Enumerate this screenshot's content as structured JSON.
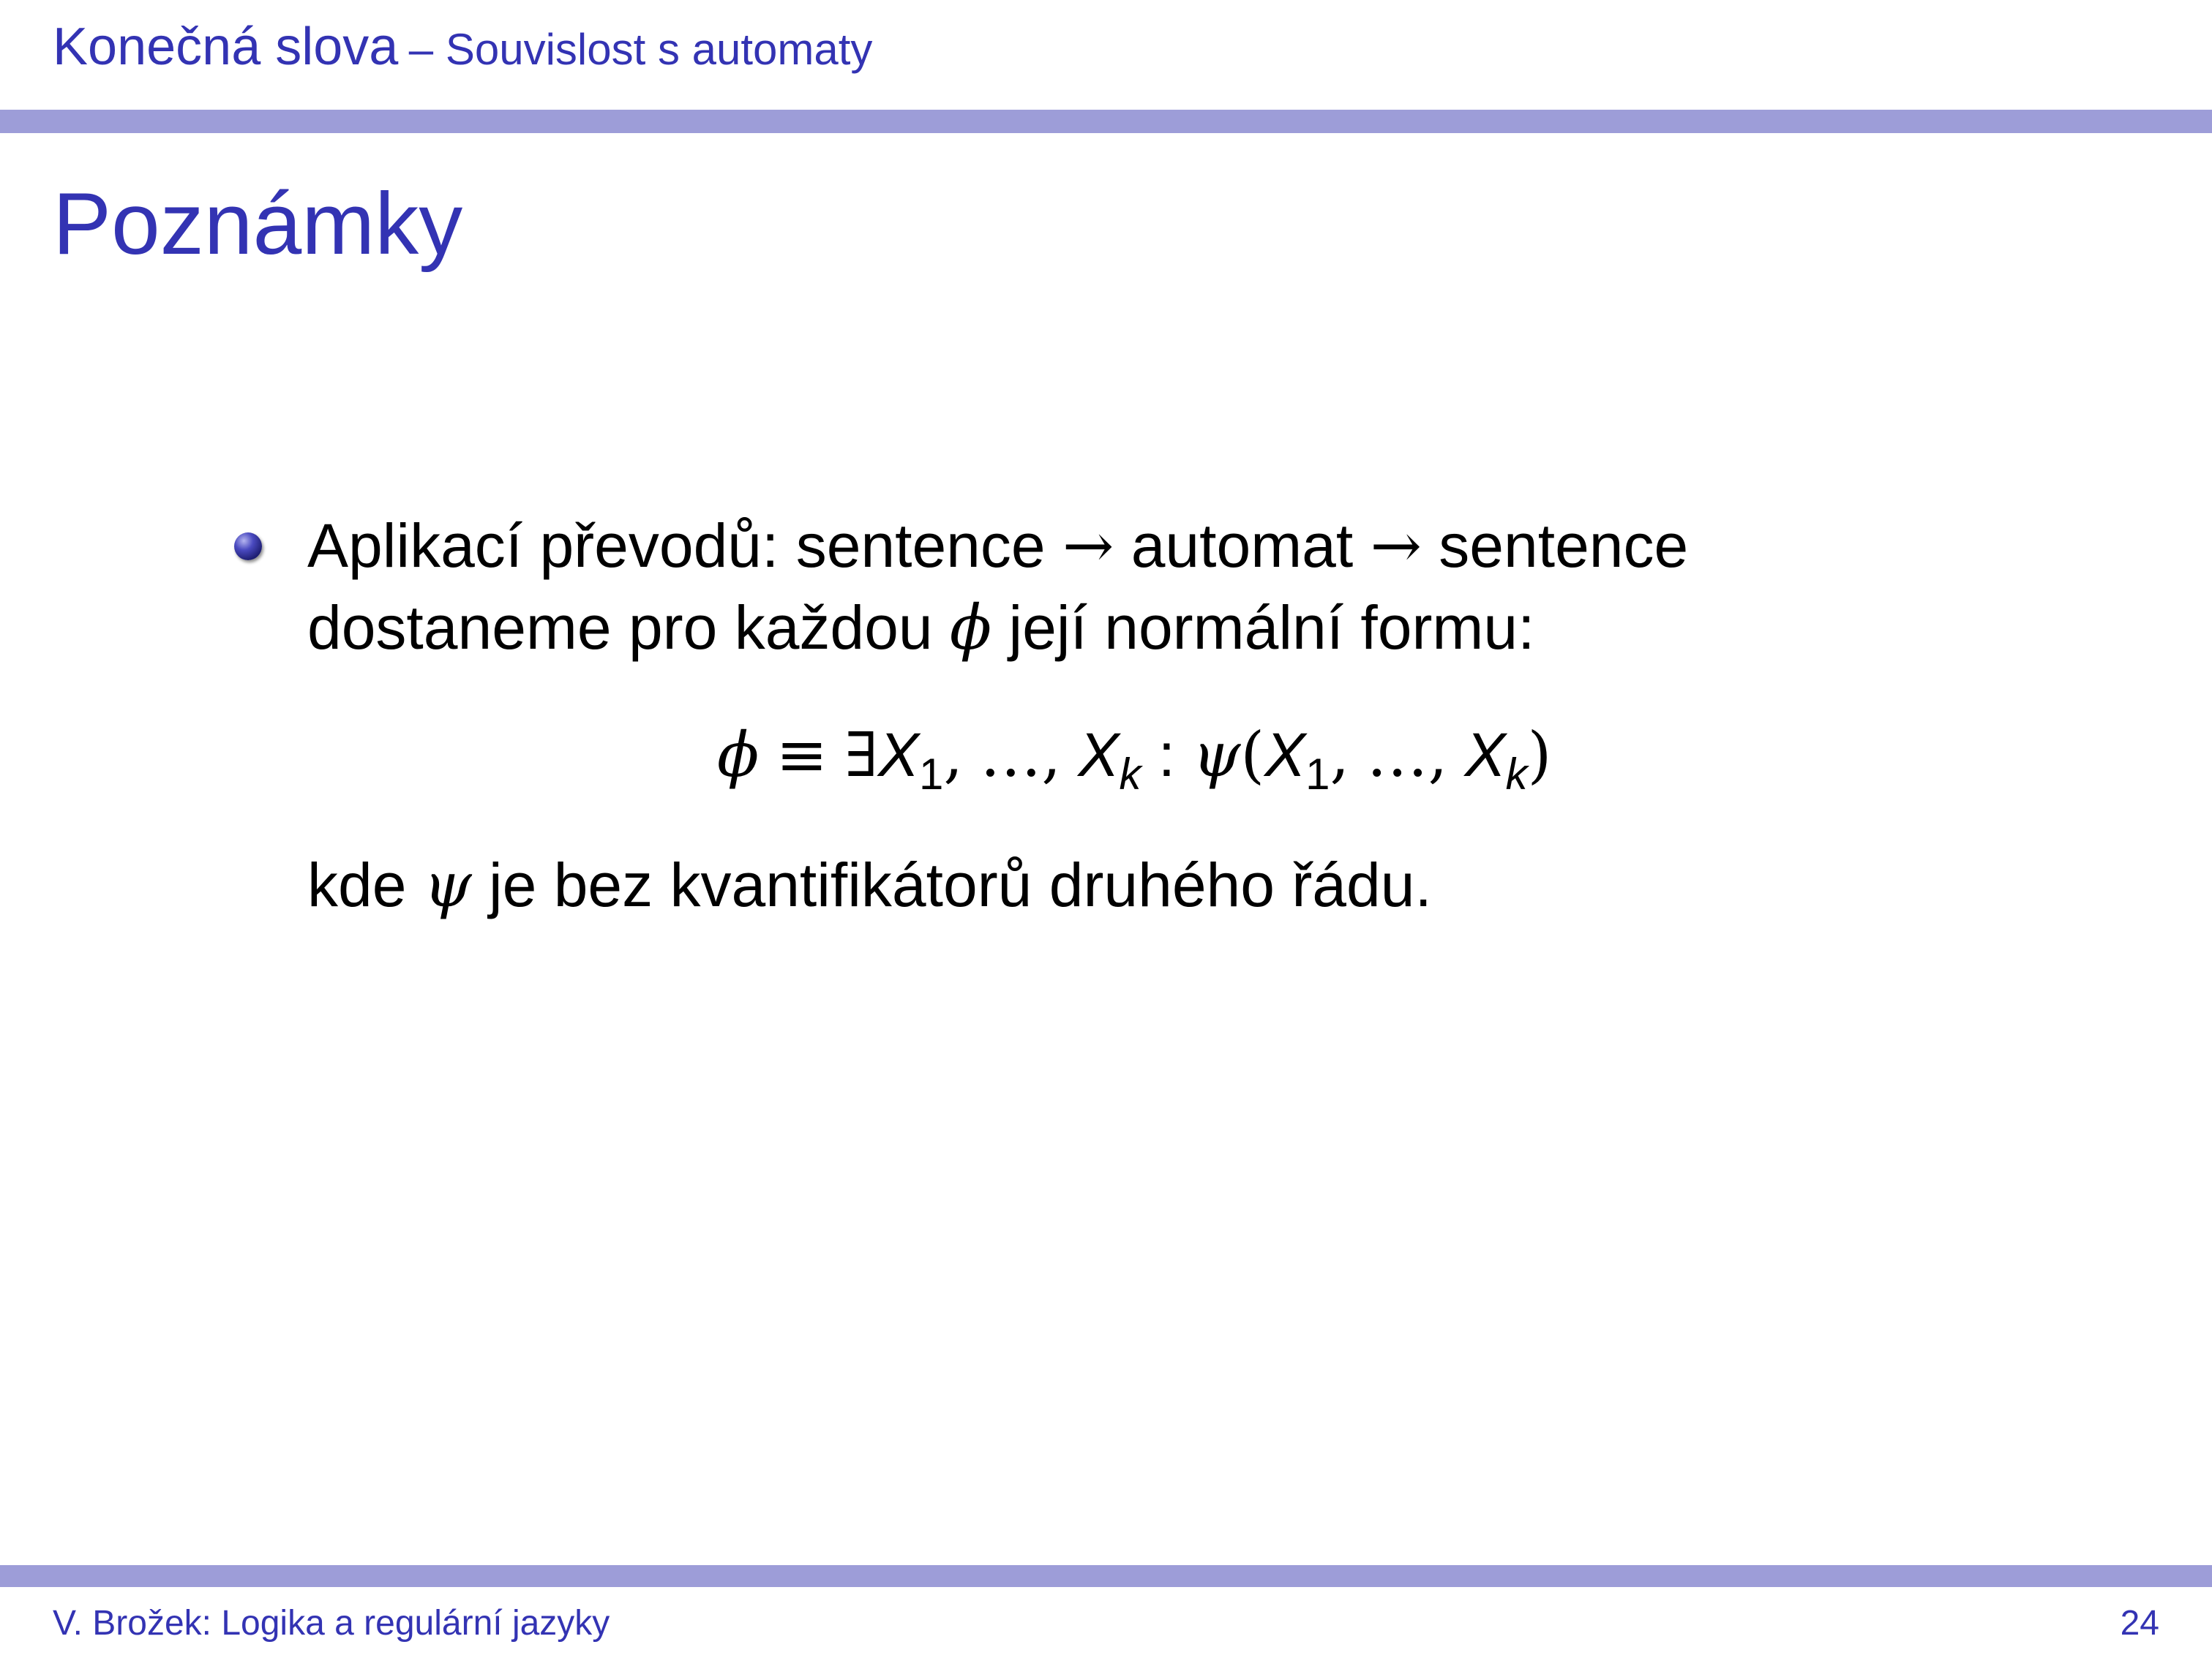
{
  "header": {
    "section": "Konečná slova",
    "subsection": "– Souvislost s automaty"
  },
  "frame": {
    "title": "Poznámky"
  },
  "content": {
    "line1_prefix": "Aplikací převodů: sentence",
    "arrow1": "→",
    "line1_middle": "automat",
    "arrow2": "→",
    "line1_suffix": "sentence",
    "line2_prefix": "dostaneme pro každou",
    "phi": "ϕ",
    "line2_suffix": "její normální formu:",
    "formula": {
      "phi": "ϕ",
      "equiv": "≡",
      "exists": "∃",
      "X": "X",
      "sub1": "1",
      "comma": ",",
      "dots": "…",
      "subk": "k",
      "colon": ":",
      "psi": "ψ",
      "lparen": "(",
      "rparen": ")"
    },
    "line3_prefix": "kde",
    "psi": "ψ",
    "line3_suffix": "je bez kvantifikátorů druhého řádu."
  },
  "footer": {
    "author": "V. Brožek: Logika a regulární jazyky",
    "page": "24"
  },
  "colors": {
    "accent": "#3333b3",
    "bar": "#9d9dd8"
  }
}
